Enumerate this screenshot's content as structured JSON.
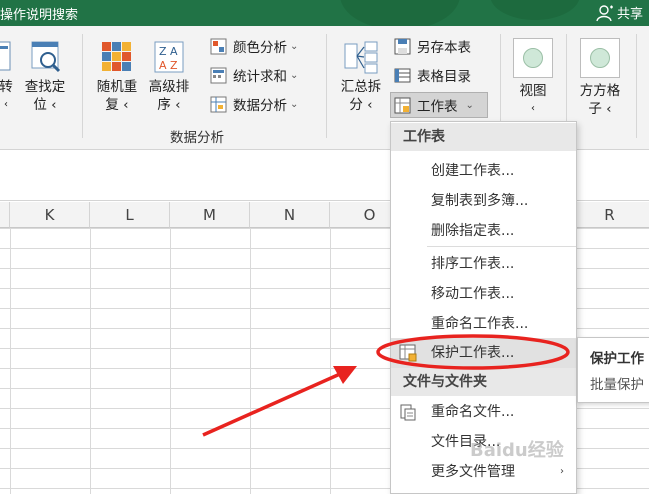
{
  "titlebar": {
    "text": "操作说明搜索",
    "share_label": "共享",
    "bg_color": "#217346"
  },
  "ribbon": {
    "buttons": {
      "zhuan": {
        "line1": "转",
        "line2": "‹"
      },
      "chazhaodingwei": {
        "line1": "查找定",
        "line2": "位 ‹"
      },
      "suijichongfu": {
        "line1": "随机重",
        "line2": "复 ‹"
      },
      "gaojipaixu": {
        "line1": "高级排",
        "line2": "序 ‹"
      },
      "huizongchaifen": {
        "line1": "汇总拆",
        "line2": "分 ‹"
      },
      "shitu": {
        "line1": "视图",
        "line2": "‹"
      },
      "fangfangge": {
        "line1": "方方格",
        "line2": "子 ‹"
      }
    },
    "small": {
      "yansefenxi": "颜色分析",
      "tongjiqiuhe": "统计求和",
      "shujufenxi": "数据分析",
      "lingcunbenbiao": "另存本表",
      "biaogemulu": "表格目录",
      "gongzuobiao": "工作表"
    },
    "group_label_data": "数据分析"
  },
  "grid": {
    "columns": [
      "K",
      "L",
      "M",
      "N",
      "O",
      "R"
    ]
  },
  "dropdown": {
    "header1": "工作表",
    "header2": "文件与文件夹",
    "items": [
      "创建工作表...",
      "复制表到多簿...",
      "删除指定表...",
      "排序工作表...",
      "移动工作表...",
      "重命名工作表...",
      "保护工作表...",
      "重命名文件...",
      "文件目录...",
      "更多文件管理"
    ],
    "more_arrow": "›"
  },
  "tooltip": {
    "title": "保护工作",
    "body": "批量保护"
  },
  "watermark": "Baidu经验",
  "colors": {
    "accent_green": "#217346",
    "annotation_red": "#e8231f",
    "highlight_gray": "#e1e1e1"
  }
}
